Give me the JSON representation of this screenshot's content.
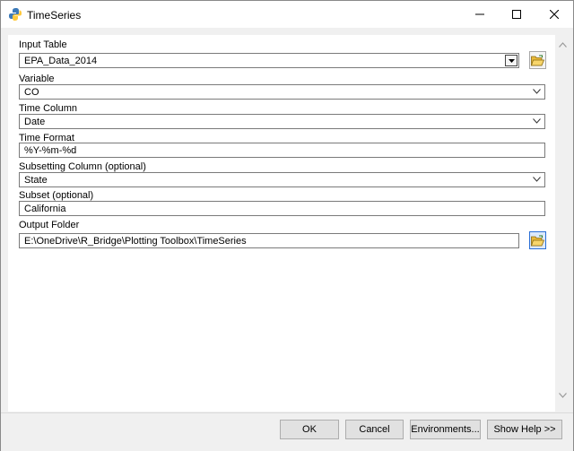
{
  "window": {
    "title": "TimeSeries"
  },
  "colors": {
    "accent": "#2a6fd6",
    "background": "#f0f0f0"
  },
  "icons": {
    "app": "python-tool-icon",
    "minimize": "minimize-icon",
    "maximize": "maximize-icon",
    "close": "close-icon",
    "folder": "open-folder-icon"
  },
  "form": {
    "input_table": {
      "label": "Input Table",
      "value": "EPA_Data_2014"
    },
    "variable": {
      "label": "Variable",
      "value": "CO"
    },
    "time_column": {
      "label": "Time Column",
      "value": "Date"
    },
    "time_format": {
      "label": "Time Format",
      "value": "%Y-%m-%d"
    },
    "subset_column": {
      "label": "Subsetting Column (optional)",
      "value": "State"
    },
    "subset": {
      "label": "Subset (optional)",
      "value": "California"
    },
    "output_folder": {
      "label": "Output Folder",
      "value": "E:\\OneDrive\\R_Bridge\\Plotting Toolbox\\TimeSeries"
    }
  },
  "buttons": {
    "ok": "OK",
    "cancel": "Cancel",
    "environments": "Environments...",
    "show_help": "Show Help >>"
  }
}
